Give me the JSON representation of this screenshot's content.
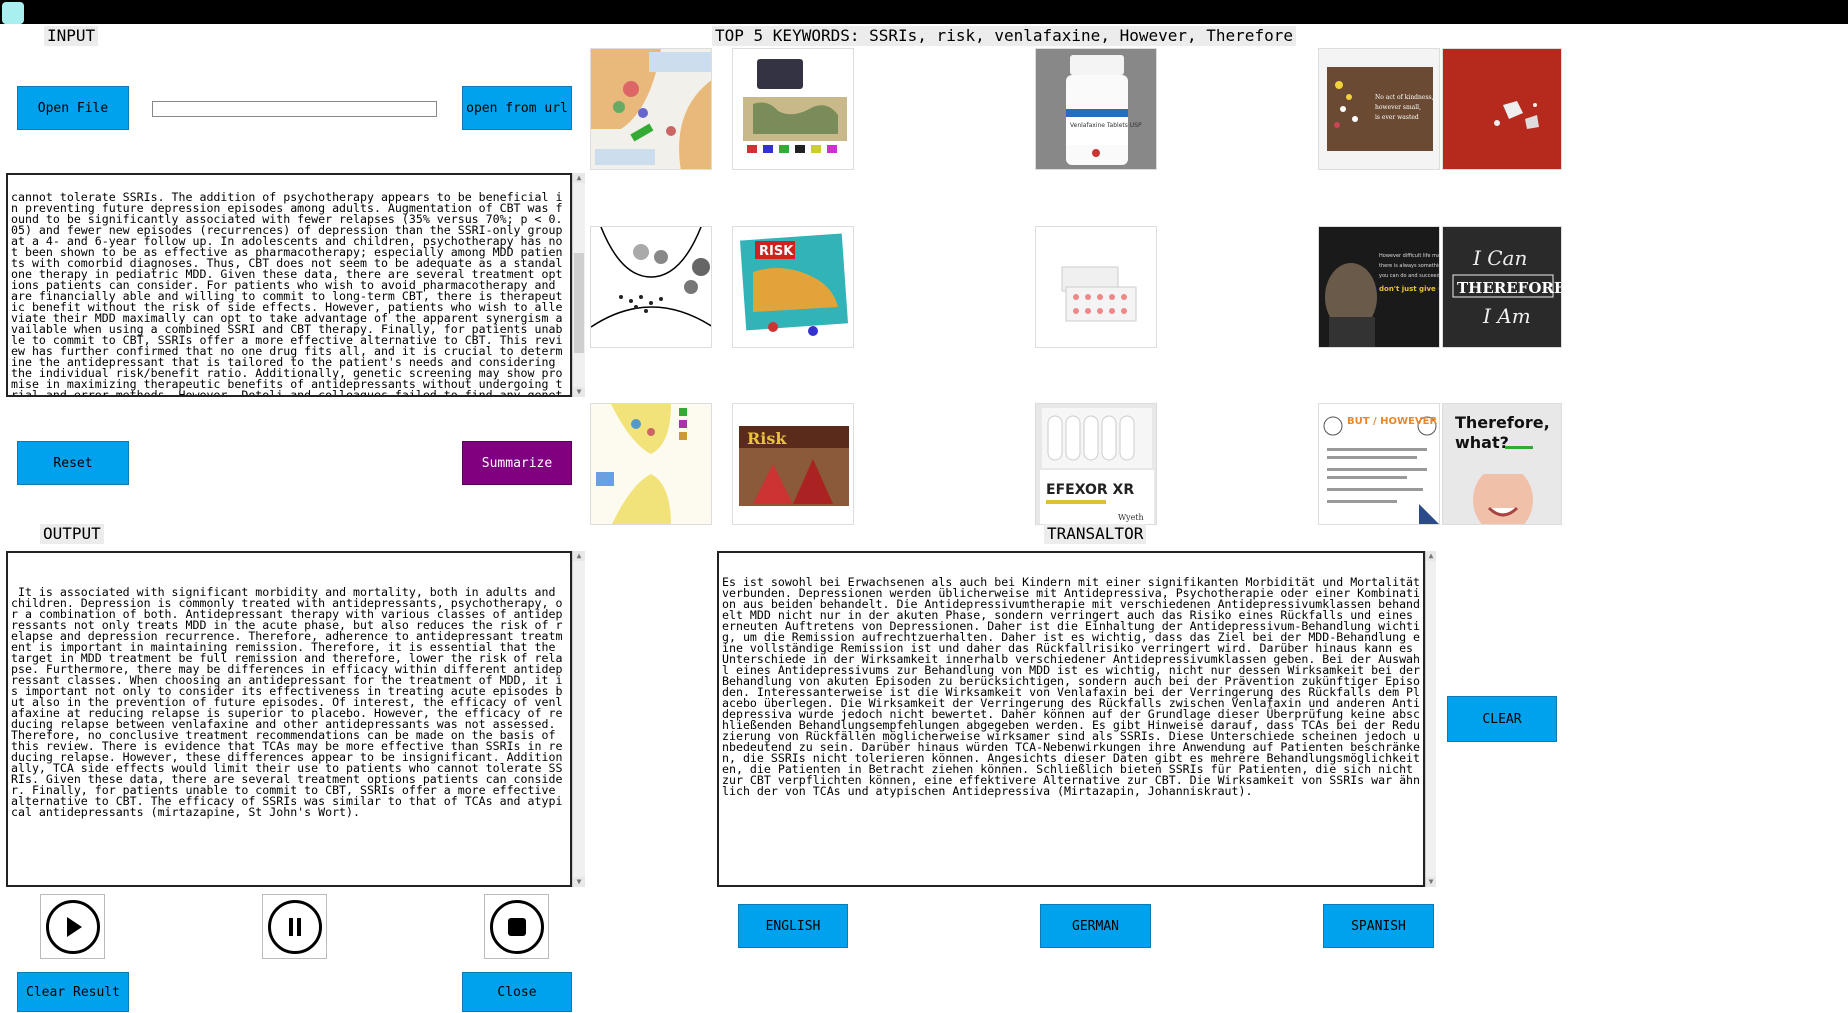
{
  "input": {
    "label": "INPUT",
    "open_file": "Open File",
    "open_url": "open from url",
    "url_value": "",
    "text": "cannot tolerate SSRIs. The addition of psychotherapy appears to be beneficial in preventing future depression episodes among adults. Augmentation of CBT was found to be significantly associated with fewer relapses (35% versus 70%; p < 0.05) and fewer new episodes (recurrences) of depression than the SSRI-only group at a 4- and 6-year follow up. In adolescents and children, psychotherapy has not been shown to be as effective as pharmacotherapy; especially among MDD patients with comorbid diagnoses. Thus, CBT does not seem to be adequate as a standalone therapy in pediatric MDD. Given these data, there are several treatment options patients can consider. For patients who wish to avoid pharmacotherapy and are financially able and willing to commit to long-term CBT, there is therapeutic benefit without the risk of side effects. However, patients who wish to alleviate their MDD maximally can opt to take advantage of the apparent synergism available when using a combined SSRI and CBT therapy. Finally, for patients unable to commit to CBT, SSRIs offer a more effective alternative to CBT. This review has further confirmed that no one drug fits all, and it is crucial to determine the antidepressant that is tailored to the patient's needs and considering the individual risk/benefit ratio. Additionally, genetic screening may show promise in maximizing therapeutic benefits of antidepressants without undergoing trial-and-error methods. However, Dotoli and colleagues failed to find any genetic markers that correlated with SSRI response. Future research of MDD treatment should be aimed at finding ways to customize comprehensive treatment for patients. Traditionally,",
    "reset": "Reset",
    "summarize": "Summarize"
  },
  "keywords": {
    "label": "TOP 5 KEYWORDS: SSRIs, risk, venlafaxine, However, Therefore"
  },
  "output": {
    "label": "OUTPUT",
    "text": " It is associated with significant morbidity and mortality, both in adults and children. Depression is commonly treated with antidepressants, psychotherapy, or a combination of both. Antidepressant therapy with various classes of antidepressants not only treats MDD in the acute phase, but also reduces the risk of relapse and depression recurrence. Therefore, adherence to antidepressant treatment is important in maintaining remission. Therefore, it is essential that the target in MDD treatment be full remission and therefore, lower the risk of relapse. Furthermore, there may be differences in efficacy within different antidepressant classes. When choosing an antidepressant for the treatment of MDD, it is important not only to consider its effectiveness in treating acute episodes but also in the prevention of future episodes. Of interest, the efficacy of venlafaxine at reducing relapse is superior to placebo. However, the efficacy of reducing relapse between venlafaxine and other antidepressants was not assessed. Therefore, no conclusive treatment recommendations can be made on the basis of this review. There is evidence that TCAs may be more effective than SSRIs in reducing relapse. However, these differences appear to be insignificant. Additionally, TCA side effects would limit their use to patients who cannot tolerate SSRIs. Given these data, there are several treatment options patients can consider. Finally, for patients unable to commit to CBT, SSRIs offer a more effective alternative to CBT. The efficacy of SSRIs was similar to that of TCAs and atypical antidepressants (mirtazapine, St John's Wort).",
    "clear_result": "Clear Result",
    "close": "Close"
  },
  "translator": {
    "label": "TRANSALTOR",
    "text": "Es ist sowohl bei Erwachsenen als auch bei Kindern mit einer signifikanten Morbidität und Mortalität verbunden. Depressionen werden üblicherweise mit Antidepressiva, Psychotherapie oder einer Kombination aus beiden behandelt. Die Antidepressivumtherapie mit verschiedenen Antidepressivumklassen behandelt MDD nicht nur in der akuten Phase, sondern verringert auch das Risiko eines Rückfalls und eines erneuten Auftretens von Depressionen. Daher ist die Einhaltung der Antidepressivum-Behandlung wichtig, um die Remission aufrechtzuerhalten. Daher ist es wichtig, dass das Ziel bei der MDD-Behandlung eine vollständige Remission ist und daher das Rückfallrisiko verringert wird. Darüber hinaus kann es Unterschiede in der Wirksamkeit innerhalb verschiedener Antidepressivumklassen geben. Bei der Auswahl eines Antidepressivums zur Behandlung von MDD ist es wichtig, nicht nur dessen Wirksamkeit bei der Behandlung von akuten Episoden zu berücksichtigen, sondern auch bei der Prävention zukünftiger Episoden. Interessanterweise ist die Wirksamkeit von Venlafaxin bei der Verringerung des Rückfalls dem Placebo überlegen. Die Wirksamkeit der Verringerung des Rückfalls zwischen Venlafaxin und anderen Antidepressiva wurde jedoch nicht bewertet. Daher können auf der Grundlage dieser Überprüfung keine abschließenden Behandlungsempfehlungen abgegeben werden. Es gibt Hinweise darauf, dass TCAs bei der Reduzierung von Rückfällen möglicherweise wirksamer sind als SSRIs. Diese Unterschiede scheinen jedoch unbedeutend zu sein. Darüber hinaus würden TCA-Nebenwirkungen ihre Anwendung auf Patienten beschränken, die SSRIs nicht tolerieren können. Angesichts dieser Daten gibt es mehrere Behandlungsmöglichkeiten, die Patienten in Betracht ziehen können. Schließlich bieten SSRIs für Patienten, die sich nicht zur CBT verpflichten können, eine effektivere Alternative zur CBT. Die Wirksamkeit von SSRIs war ähnlich der von TCAs und atypischen Antidepressiva (Mirtazapin, Johanniskraut).",
    "clear": "CLEAR",
    "english": "ENGLISH",
    "german": "GERMAN",
    "spanish": "SPANISH"
  },
  "images": {
    "effexor_label": "EFEXOR XR",
    "wyeth": "Wyeth",
    "venlafaxine_label": "Venlafaxine Tablets USP",
    "risk_title": "RISK",
    "risk_title2": "Risk",
    "quote1": "No act of kindness, however small, is ever wasted",
    "hawking_quote": "However difficult life may seem, there is always something you can do and succeed at. don't just give up.",
    "can_therefore": "I Can Therefore I Am",
    "but_however": "BUT / HOWEVER",
    "therefore_what": "Therefore, what?"
  }
}
